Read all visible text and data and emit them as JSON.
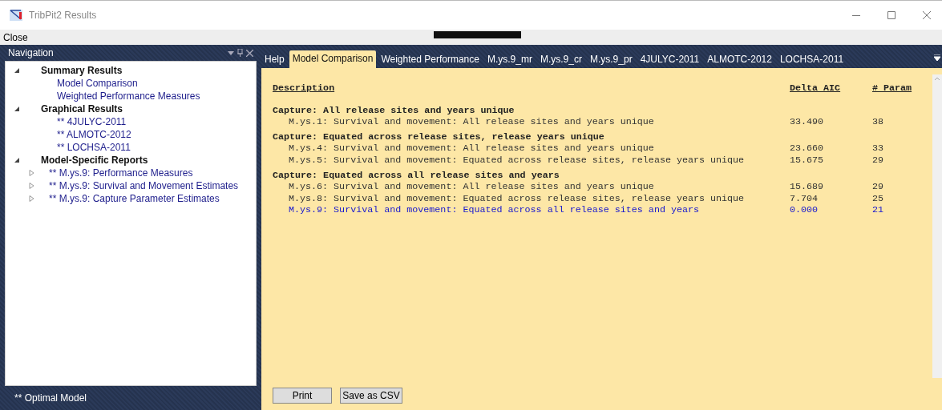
{
  "window": {
    "title": "TribPit2 Results"
  },
  "menu": [
    "Close"
  ],
  "navigation": {
    "title": "Navigation",
    "tree": [
      {
        "label": "Summary Results",
        "expanded": true,
        "children": [
          {
            "label": "Model Comparison"
          },
          {
            "label": "Weighted Performance Measures"
          }
        ]
      },
      {
        "label": "Graphical Results",
        "expanded": true,
        "children": [
          {
            "label": "** 4JULYC-2011"
          },
          {
            "label": "** ALMOTC-2012"
          },
          {
            "label": "** LOCHSA-2011"
          }
        ]
      },
      {
        "label": "Model-Specific Reports",
        "expanded": true,
        "children": [
          {
            "label": "** M.ys.9: Performance Measures",
            "expanded": false
          },
          {
            "label": "** M.ys.9: Survival and Movement Estimates",
            "expanded": false
          },
          {
            "label": "** M.ys.9: Capture Parameter Estimates",
            "expanded": false
          }
        ]
      }
    ],
    "footer": "** Optimal Model"
  },
  "tabs": [
    {
      "label": "Help",
      "selected": false
    },
    {
      "label": "Model Comparison",
      "selected": true
    },
    {
      "label": "Weighted Performance",
      "selected": false
    },
    {
      "label": "M.ys.9_mr",
      "selected": false
    },
    {
      "label": "M.ys.9_cr",
      "selected": false
    },
    {
      "label": "M.ys.9_pr",
      "selected": false
    },
    {
      "label": "4JULYC-2011",
      "selected": false
    },
    {
      "label": "ALMOTC-2012",
      "selected": false
    },
    {
      "label": "LOCHSA-2011",
      "selected": false
    }
  ],
  "report": {
    "columns": [
      "Description",
      "Delta AIC",
      "# Param"
    ],
    "groups": [
      {
        "title": "Capture: All release sites and years unique",
        "rows": [
          {
            "cells": [
              "M.ys.1: Survival and movement: All release sites and years unique",
              "33.490",
              "38"
            ],
            "optimal": false
          }
        ]
      },
      {
        "title": "Capture: Equated across release sites, release years unique",
        "rows": [
          {
            "cells": [
              "M.ys.4: Survival and movement: All release sites and years unique",
              "23.660",
              "33"
            ],
            "optimal": false
          },
          {
            "cells": [
              "M.ys.5: Survival and movement: Equated across release sites, release years unique",
              "15.675",
              "29"
            ],
            "optimal": false
          }
        ]
      },
      {
        "title": "Capture: Equated across all release sites and years",
        "rows": [
          {
            "cells": [
              "M.ys.6: Survival and movement: All release sites and years unique",
              "15.689",
              "29"
            ],
            "optimal": false
          },
          {
            "cells": [
              "M.ys.8: Survival and movement: Equated across release sites, release years unique",
              "7.704",
              "25"
            ],
            "optimal": false
          },
          {
            "cells": [
              "M.ys.9: Survival and movement: Equated across all release sites and years",
              "0.000",
              "21"
            ],
            "optimal": true
          }
        ]
      }
    ]
  },
  "buttons": [
    "Print",
    "Save as CSV"
  ]
}
